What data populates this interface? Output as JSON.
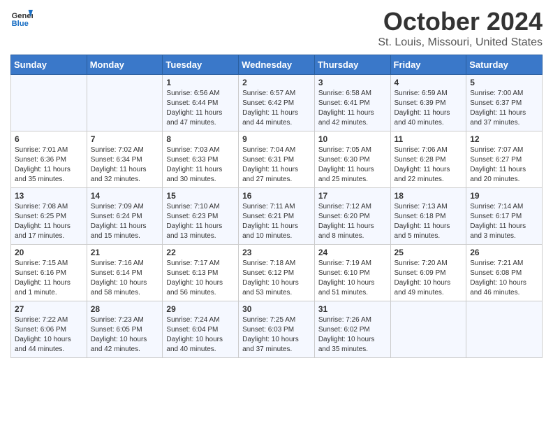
{
  "header": {
    "logo_general": "General",
    "logo_blue": "Blue",
    "title": "October 2024",
    "subtitle": "St. Louis, Missouri, United States"
  },
  "days_of_week": [
    "Sunday",
    "Monday",
    "Tuesday",
    "Wednesday",
    "Thursday",
    "Friday",
    "Saturday"
  ],
  "weeks": [
    [
      {
        "day": "",
        "info": ""
      },
      {
        "day": "",
        "info": ""
      },
      {
        "day": "1",
        "info": "Sunrise: 6:56 AM\nSunset: 6:44 PM\nDaylight: 11 hours and 47 minutes."
      },
      {
        "day": "2",
        "info": "Sunrise: 6:57 AM\nSunset: 6:42 PM\nDaylight: 11 hours and 44 minutes."
      },
      {
        "day": "3",
        "info": "Sunrise: 6:58 AM\nSunset: 6:41 PM\nDaylight: 11 hours and 42 minutes."
      },
      {
        "day": "4",
        "info": "Sunrise: 6:59 AM\nSunset: 6:39 PM\nDaylight: 11 hours and 40 minutes."
      },
      {
        "day": "5",
        "info": "Sunrise: 7:00 AM\nSunset: 6:37 PM\nDaylight: 11 hours and 37 minutes."
      }
    ],
    [
      {
        "day": "6",
        "info": "Sunrise: 7:01 AM\nSunset: 6:36 PM\nDaylight: 11 hours and 35 minutes."
      },
      {
        "day": "7",
        "info": "Sunrise: 7:02 AM\nSunset: 6:34 PM\nDaylight: 11 hours and 32 minutes."
      },
      {
        "day": "8",
        "info": "Sunrise: 7:03 AM\nSunset: 6:33 PM\nDaylight: 11 hours and 30 minutes."
      },
      {
        "day": "9",
        "info": "Sunrise: 7:04 AM\nSunset: 6:31 PM\nDaylight: 11 hours and 27 minutes."
      },
      {
        "day": "10",
        "info": "Sunrise: 7:05 AM\nSunset: 6:30 PM\nDaylight: 11 hours and 25 minutes."
      },
      {
        "day": "11",
        "info": "Sunrise: 7:06 AM\nSunset: 6:28 PM\nDaylight: 11 hours and 22 minutes."
      },
      {
        "day": "12",
        "info": "Sunrise: 7:07 AM\nSunset: 6:27 PM\nDaylight: 11 hours and 20 minutes."
      }
    ],
    [
      {
        "day": "13",
        "info": "Sunrise: 7:08 AM\nSunset: 6:25 PM\nDaylight: 11 hours and 17 minutes."
      },
      {
        "day": "14",
        "info": "Sunrise: 7:09 AM\nSunset: 6:24 PM\nDaylight: 11 hours and 15 minutes."
      },
      {
        "day": "15",
        "info": "Sunrise: 7:10 AM\nSunset: 6:23 PM\nDaylight: 11 hours and 13 minutes."
      },
      {
        "day": "16",
        "info": "Sunrise: 7:11 AM\nSunset: 6:21 PM\nDaylight: 11 hours and 10 minutes."
      },
      {
        "day": "17",
        "info": "Sunrise: 7:12 AM\nSunset: 6:20 PM\nDaylight: 11 hours and 8 minutes."
      },
      {
        "day": "18",
        "info": "Sunrise: 7:13 AM\nSunset: 6:18 PM\nDaylight: 11 hours and 5 minutes."
      },
      {
        "day": "19",
        "info": "Sunrise: 7:14 AM\nSunset: 6:17 PM\nDaylight: 11 hours and 3 minutes."
      }
    ],
    [
      {
        "day": "20",
        "info": "Sunrise: 7:15 AM\nSunset: 6:16 PM\nDaylight: 11 hours and 1 minute."
      },
      {
        "day": "21",
        "info": "Sunrise: 7:16 AM\nSunset: 6:14 PM\nDaylight: 10 hours and 58 minutes."
      },
      {
        "day": "22",
        "info": "Sunrise: 7:17 AM\nSunset: 6:13 PM\nDaylight: 10 hours and 56 minutes."
      },
      {
        "day": "23",
        "info": "Sunrise: 7:18 AM\nSunset: 6:12 PM\nDaylight: 10 hours and 53 minutes."
      },
      {
        "day": "24",
        "info": "Sunrise: 7:19 AM\nSunset: 6:10 PM\nDaylight: 10 hours and 51 minutes."
      },
      {
        "day": "25",
        "info": "Sunrise: 7:20 AM\nSunset: 6:09 PM\nDaylight: 10 hours and 49 minutes."
      },
      {
        "day": "26",
        "info": "Sunrise: 7:21 AM\nSunset: 6:08 PM\nDaylight: 10 hours and 46 minutes."
      }
    ],
    [
      {
        "day": "27",
        "info": "Sunrise: 7:22 AM\nSunset: 6:06 PM\nDaylight: 10 hours and 44 minutes."
      },
      {
        "day": "28",
        "info": "Sunrise: 7:23 AM\nSunset: 6:05 PM\nDaylight: 10 hours and 42 minutes."
      },
      {
        "day": "29",
        "info": "Sunrise: 7:24 AM\nSunset: 6:04 PM\nDaylight: 10 hours and 40 minutes."
      },
      {
        "day": "30",
        "info": "Sunrise: 7:25 AM\nSunset: 6:03 PM\nDaylight: 10 hours and 37 minutes."
      },
      {
        "day": "31",
        "info": "Sunrise: 7:26 AM\nSunset: 6:02 PM\nDaylight: 10 hours and 35 minutes."
      },
      {
        "day": "",
        "info": ""
      },
      {
        "day": "",
        "info": ""
      }
    ]
  ]
}
